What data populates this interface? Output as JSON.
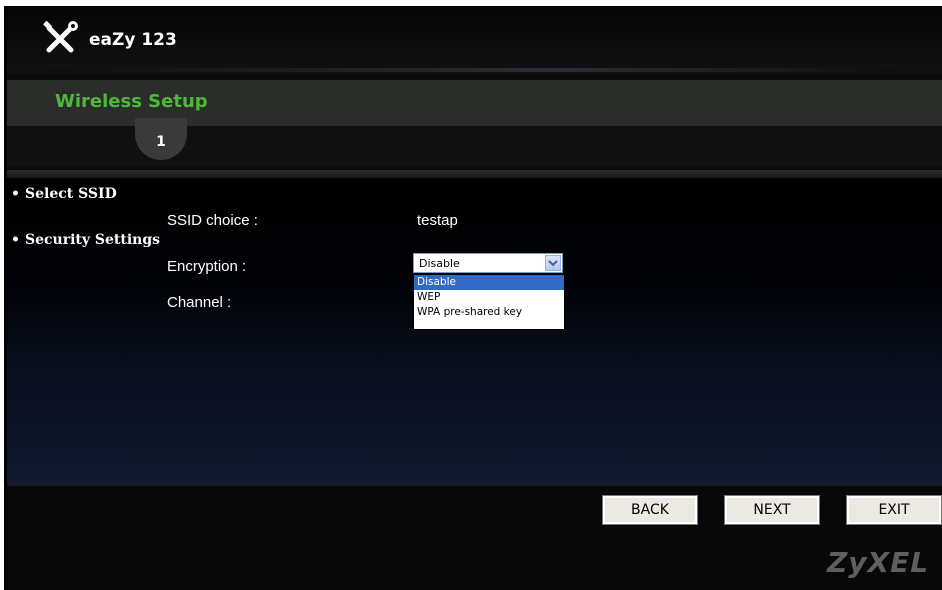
{
  "app": {
    "title": "eaZy 123",
    "icon": "tools-icon"
  },
  "section": {
    "title": "Wireless Setup",
    "step": "1"
  },
  "select_ssid": {
    "heading": "Select SSID",
    "ssid_label": "SSID choice :",
    "ssid_value": "testap"
  },
  "security": {
    "heading": "Security Settings",
    "encryption_label": "Encryption :",
    "encryption_value": "Disable",
    "encryption_options": [
      "Disable",
      "WEP",
      "WPA pre-shared key"
    ],
    "channel_label": "Channel :"
  },
  "buttons": {
    "back": "BACK",
    "next": "NEXT",
    "exit": "EXIT"
  },
  "brand": "ZyXEL",
  "colors": {
    "section_title": "#4fb83a",
    "selection": "#316ac5"
  }
}
